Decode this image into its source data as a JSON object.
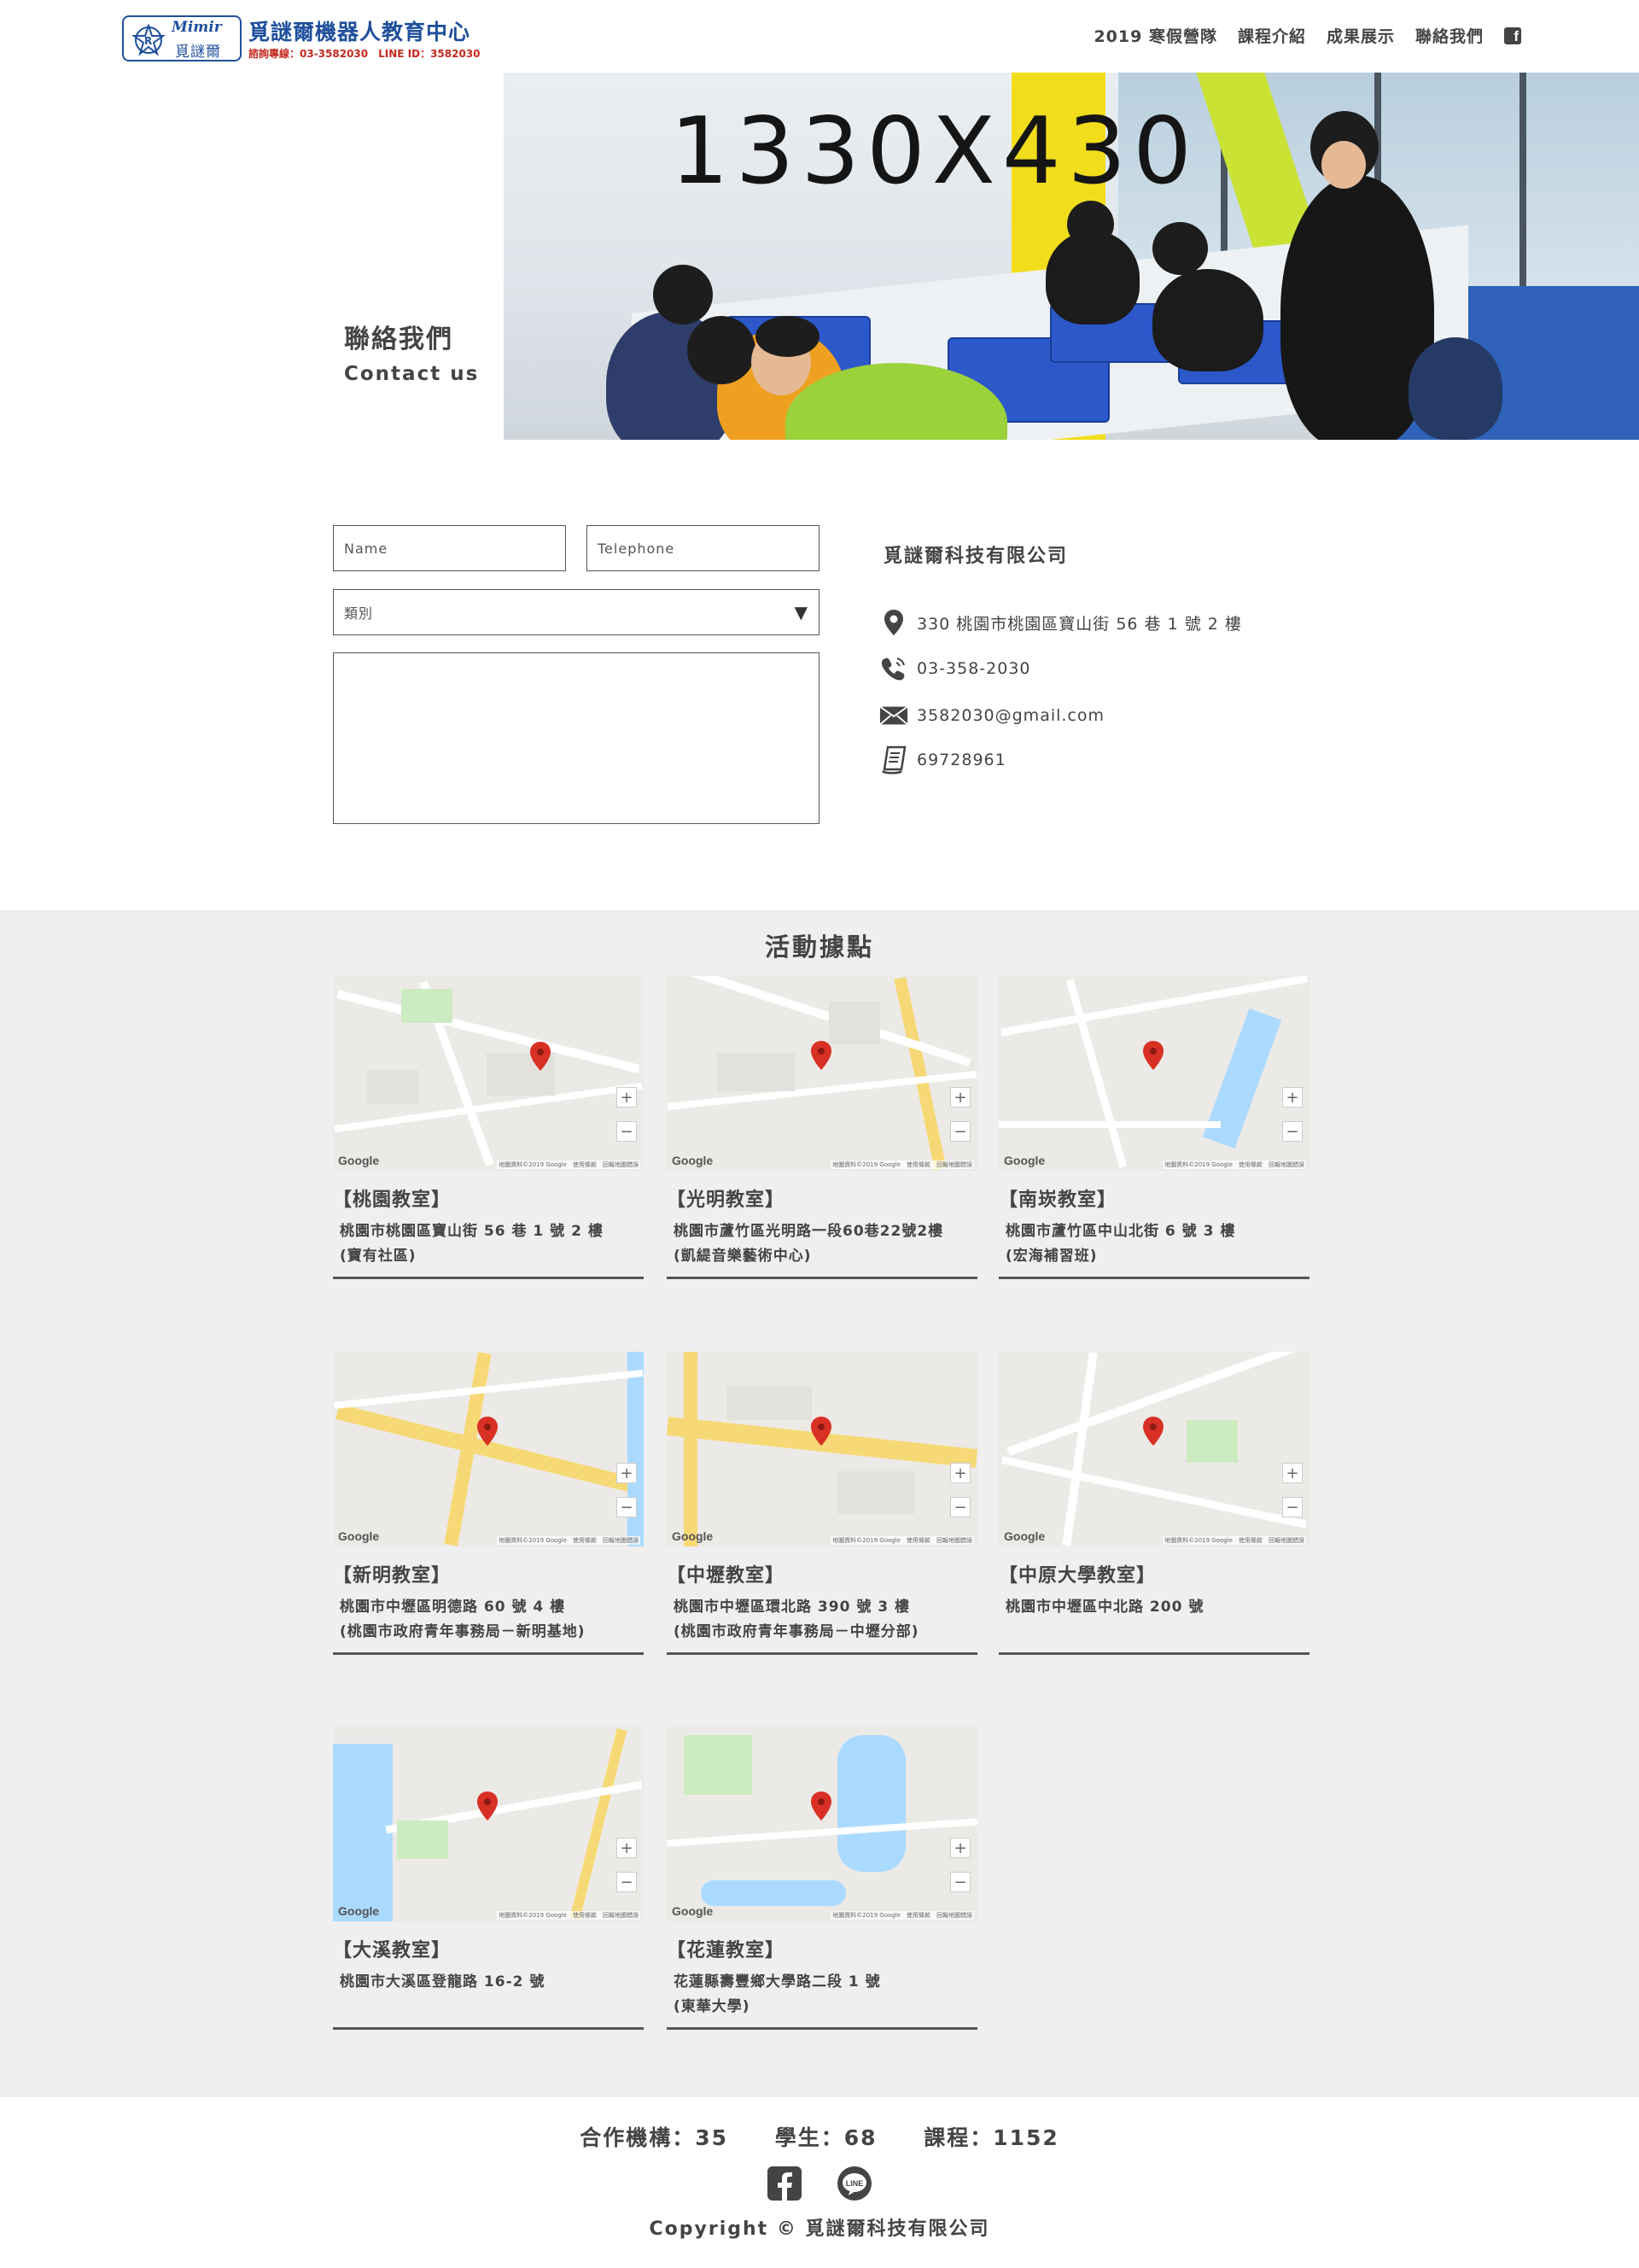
{
  "header": {
    "logo_en": "Mimir",
    "logo_zh": "覓謎爾",
    "logo_title": "覓謎爾機器人教育中心",
    "logo_sub": "諮詢專線：03-3582030　LINE ID：3582030",
    "nav": [
      "2019 寒假營隊",
      "課程介紹",
      "成果展示",
      "聯絡我們"
    ],
    "facebook_icon": "facebook-icon"
  },
  "banner": {
    "label": "1330X430"
  },
  "contact": {
    "title": "聯絡我們",
    "subtitle": "Contact us"
  },
  "form": {
    "name_placeholder": "Name",
    "tel_placeholder": "Telephone",
    "category_value": "類別",
    "message_value": ""
  },
  "company": {
    "name": "覓謎爾科技有限公司",
    "address": "330 桃園市桃園區寶山街 56 巷 1 號 2 樓",
    "phone": "03-358-2030",
    "email": "3582030@gmail.com",
    "tax_id": "69728961",
    "icons": [
      "location-pin-icon",
      "phone-icon",
      "mail-icon",
      "document-icon"
    ]
  },
  "locations": {
    "heading": "活動據點",
    "map_brand": "Google",
    "map_attribution": "地圖資料©2019 Google　使用條款　回報地圖錯誤",
    "zoom_in": "+",
    "zoom_out": "−",
    "items": [
      {
        "title": "【桃園教室】",
        "line1": "桃園市桃園區寶山街 56 巷 1 號 2 樓",
        "line2": "(寶有社區)"
      },
      {
        "title": "【光明教室】",
        "line1": "桃園市蘆竹區光明路一段60巷22號2樓",
        "line2": "(凱緹音樂藝術中心)"
      },
      {
        "title": "【南崁教室】",
        "line1": "桃園市蘆竹區中山北街 6 號 3 樓",
        "line2": "(宏海補習班)"
      },
      {
        "title": "【新明教室】",
        "line1": "桃園市中壢區明德路 60 號 4 樓",
        "line2": "(桃園市政府青年事務局－新明基地)"
      },
      {
        "title": "【中壢教室】",
        "line1": "桃園市中壢區環北路 390 號 3 樓",
        "line2": "(桃園市政府青年事務局－中壢分部)"
      },
      {
        "title": "【中原大學教室】",
        "line1": "桃園市中壢區中北路 200 號",
        "line2": ""
      },
      {
        "title": "【大溪教室】",
        "line1": "桃園市大溪區登龍路 16-2 號",
        "line2": ""
      },
      {
        "title": "【花蓮教室】",
        "line1": "花蓮縣壽豐鄉大學路二段 1 號",
        "line2": "(東華大學)"
      }
    ]
  },
  "footer": {
    "stats": [
      "合作機構：35",
      "學生：68",
      "課程：1152"
    ],
    "social": [
      "facebook-icon",
      "line-icon"
    ],
    "line_text": "LINE",
    "copyright": "Copyright © 覓謎爾科技有限公司"
  },
  "colors": {
    "brand_blue": "#1f4f9c",
    "brand_red": "#c52a1f",
    "text": "#444444",
    "section_bg": "#efefef",
    "map_pin": "#d93025"
  }
}
